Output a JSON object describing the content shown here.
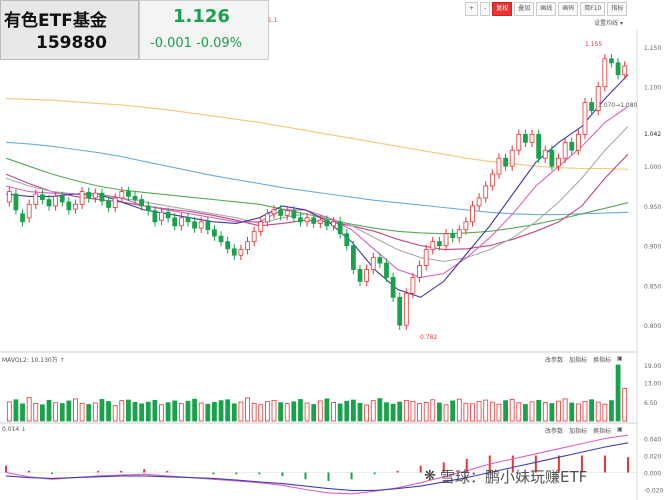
{
  "fund": {
    "name": "有色ETF基金",
    "code": "159880",
    "price": "1.126",
    "change": "-0.001",
    "change_pct": "-0.09%"
  },
  "toolbar": {
    "buttons": [
      "+",
      "-",
      "复权",
      "叠加",
      "画线",
      "画码",
      "简F10",
      "指标"
    ],
    "active_index": 2
  },
  "settings_label": "设置均线",
  "main_labels": {
    "high_label": "1.155",
    "ref_label": "1.070→1.080",
    "low_label": "0.782",
    "top_marker": "1.1"
  },
  "indicator_vol": {
    "label": "MAVOL2: 10.130万",
    "buttons": [
      "改参数",
      "加指标",
      "换指标"
    ]
  },
  "indicator_macd": {
    "label": "0.014",
    "buttons": [
      "改参数",
      "加指标",
      "换指标"
    ]
  },
  "watermark": "雪球：鹏小妹玩赚ETF",
  "watermark_logo": "❋",
  "colors": {
    "up": "#ee3333",
    "down": "#17a34a"
  },
  "chart_data": {
    "type": "candlestick",
    "y_ticks": [
      "1.150",
      "1.100",
      "1.042",
      "1.000",
      "0.950",
      "0.900",
      "0.850",
      "0.800"
    ],
    "y_ticks_vol": [
      "19.00",
      "13.00",
      "6.50"
    ],
    "y_ticks_macd": [
      "0.040",
      "0.020",
      "0.000",
      "-0.020"
    ],
    "ma_series": [
      {
        "color": "#f5c87a",
        "values": [
          1.085,
          1.084,
          1.083,
          1.081,
          1.079,
          1.077,
          1.074,
          1.071,
          1.067,
          1.063,
          1.059,
          1.055,
          1.05,
          1.045,
          1.04,
          1.035,
          1.03,
          1.025,
          1.02,
          1.015,
          1.01,
          1.006,
          1.003,
          1.0,
          0.998,
          0.997,
          0.997,
          0.996
        ]
      },
      {
        "color": "#6ab0d8",
        "values": [
          1.03,
          1.028,
          1.025,
          1.021,
          1.017,
          1.012,
          1.006,
          1.0,
          0.994,
          0.988,
          0.983,
          0.978,
          0.973,
          0.969,
          0.965,
          0.961,
          0.957,
          0.954,
          0.951,
          0.948,
          0.945,
          0.942,
          0.94,
          0.939,
          0.939,
          0.94,
          0.941,
          0.942
        ]
      },
      {
        "color": "#57a85a",
        "values": [
          1.01,
          1.0,
          0.99,
          0.982,
          0.975,
          0.97,
          0.967,
          0.964,
          0.961,
          0.958,
          0.955,
          0.952,
          0.946,
          0.94,
          0.933,
          0.927,
          0.922,
          0.918,
          0.916,
          0.915,
          0.916,
          0.918,
          0.922,
          0.927,
          0.933,
          0.94,
          0.947,
          0.954
        ]
      },
      {
        "color": "#c0468a",
        "values": [
          0.99,
          0.978,
          0.968,
          0.962,
          0.958,
          0.955,
          0.95,
          0.946,
          0.943,
          0.938,
          0.932,
          0.925,
          0.928,
          0.932,
          0.93,
          0.925,
          0.918,
          0.908,
          0.9,
          0.895,
          0.896,
          0.9,
          0.908,
          0.918,
          0.93,
          0.95,
          0.985,
          1.015
        ]
      },
      {
        "color": "#aaaaaa",
        "values": [
          0.985,
          0.975,
          0.968,
          0.965,
          0.962,
          0.96,
          0.955,
          0.95,
          0.945,
          0.94,
          0.935,
          0.928,
          0.935,
          0.94,
          0.935,
          0.925,
          0.91,
          0.895,
          0.885,
          0.88,
          0.885,
          0.895,
          0.91,
          0.93,
          0.955,
          0.985,
          1.02,
          1.05
        ]
      },
      {
        "color": "#e060c0",
        "values": [
          0.975,
          0.968,
          0.966,
          0.965,
          0.965,
          0.96,
          0.95,
          0.945,
          0.94,
          0.935,
          0.93,
          0.93,
          0.945,
          0.945,
          0.935,
          0.92,
          0.895,
          0.87,
          0.86,
          0.865,
          0.885,
          0.91,
          0.94,
          0.975,
          1.0,
          1.025,
          1.055,
          1.075
        ]
      },
      {
        "color": "#3a3aa0",
        "values": [
          0.965,
          0.962,
          0.962,
          0.965,
          0.965,
          0.955,
          0.945,
          0.94,
          0.935,
          0.93,
          0.928,
          0.935,
          0.95,
          0.945,
          0.93,
          0.905,
          0.87,
          0.845,
          0.835,
          0.855,
          0.89,
          0.925,
          0.965,
          1.005,
          1.03,
          1.05,
          1.085,
          1.115
        ]
      }
    ],
    "candles": [
      [
        0.955,
        0.968
      ],
      [
        0.965,
        0.945
      ],
      [
        0.94,
        0.93
      ],
      [
        0.935,
        0.952
      ],
      [
        0.952,
        0.965
      ],
      [
        0.964,
        0.958
      ],
      [
        0.958,
        0.95
      ],
      [
        0.95,
        0.962
      ],
      [
        0.962,
        0.955
      ],
      [
        0.955,
        0.945
      ],
      [
        0.946,
        0.952
      ],
      [
        0.952,
        0.968
      ],
      [
        0.967,
        0.96
      ],
      [
        0.96,
        0.966
      ],
      [
        0.966,
        0.956
      ],
      [
        0.956,
        0.948
      ],
      [
        0.948,
        0.96
      ],
      [
        0.96,
        0.968
      ],
      [
        0.968,
        0.962
      ],
      [
        0.962,
        0.958
      ],
      [
        0.958,
        0.95
      ],
      [
        0.95,
        0.944
      ],
      [
        0.944,
        0.93
      ],
      [
        0.932,
        0.942
      ],
      [
        0.942,
        0.935
      ],
      [
        0.935,
        0.925
      ],
      [
        0.925,
        0.935
      ],
      [
        0.935,
        0.93
      ],
      [
        0.93,
        0.922
      ],
      [
        0.922,
        0.93
      ],
      [
        0.93,
        0.92
      ],
      [
        0.92,
        0.912
      ],
      [
        0.912,
        0.905
      ],
      [
        0.905,
        0.896
      ],
      [
        0.896,
        0.888
      ],
      [
        0.888,
        0.895
      ],
      [
        0.895,
        0.905
      ],
      [
        0.905,
        0.918
      ],
      [
        0.918,
        0.93
      ],
      [
        0.93,
        0.94
      ],
      [
        0.94,
        0.945
      ],
      [
        0.945,
        0.938
      ],
      [
        0.938,
        0.944
      ],
      [
        0.944,
        0.935
      ],
      [
        0.935,
        0.93
      ],
      [
        0.93,
        0.935
      ],
      [
        0.935,
        0.928
      ],
      [
        0.928,
        0.932
      ],
      [
        0.932,
        0.925
      ],
      [
        0.925,
        0.93
      ],
      [
        0.93,
        0.915
      ],
      [
        0.915,
        0.9
      ],
      [
        0.9,
        0.87
      ],
      [
        0.87,
        0.855
      ],
      [
        0.855,
        0.87
      ],
      [
        0.87,
        0.885
      ],
      [
        0.885,
        0.878
      ],
      [
        0.878,
        0.86
      ],
      [
        0.86,
        0.835
      ],
      [
        0.835,
        0.8
      ],
      [
        0.8,
        0.84
      ],
      [
        0.84,
        0.86
      ],
      [
        0.86,
        0.875
      ],
      [
        0.875,
        0.895
      ],
      [
        0.895,
        0.905
      ],
      [
        0.905,
        0.9
      ],
      [
        0.9,
        0.915
      ],
      [
        0.915,
        0.91
      ],
      [
        0.91,
        0.92
      ],
      [
        0.92,
        0.93
      ],
      [
        0.93,
        0.95
      ],
      [
        0.95,
        0.96
      ],
      [
        0.96,
        0.975
      ],
      [
        0.975,
        0.99
      ],
      [
        0.99,
        1.01
      ],
      [
        1.01,
        1.0
      ],
      [
        1.0,
        1.02
      ],
      [
        1.02,
        1.04
      ],
      [
        1.04,
        1.03
      ],
      [
        1.03,
        1.04
      ],
      [
        1.04,
        1.01
      ],
      [
        1.01,
        1.02
      ],
      [
        1.02,
        1.0
      ],
      [
        1.0,
        1.01
      ],
      [
        1.01,
        1.03
      ],
      [
        1.03,
        1.02
      ],
      [
        1.02,
        1.04
      ],
      [
        1.04,
        1.08
      ],
      [
        1.08,
        1.07
      ],
      [
        1.07,
        1.1
      ],
      [
        1.1,
        1.135
      ],
      [
        1.135,
        1.13
      ],
      [
        1.13,
        1.115
      ],
      [
        1.115,
        1.126
      ]
    ],
    "volumes": [
      6.5,
      7.2,
      5.8,
      8.0,
      6.0,
      5.5,
      7.0,
      6.2,
      5.9,
      6.8,
      7.5,
      6.0,
      5.6,
      6.1,
      7.3,
      6.6,
      5.2,
      6.9,
      7.1,
      6.3,
      5.8,
      6.4,
      7.0,
      5.5,
      6.2,
      6.8,
      5.9,
      6.7,
      7.4,
      6.1,
      5.7,
      6.3,
      6.9,
      7.2,
      5.8,
      6.4,
      7.8,
      6.0,
      5.5,
      6.6,
      7.0,
      6.2,
      5.9,
      6.5,
      7.3,
      6.1,
      5.6,
      6.8,
      7.5,
      6.3,
      5.8,
      6.7,
      7.1,
      6.0,
      5.4,
      6.9,
      7.6,
      6.2,
      5.7,
      6.4,
      7.0,
      6.6,
      5.9,
      6.3,
      7.2,
      6.1,
      5.5,
      6.8,
      7.4,
      6.0,
      5.8,
      6.6,
      7.1,
      6.4,
      5.7,
      6.9,
      7.3,
      6.2,
      5.6,
      6.5,
      7.0,
      6.3,
      5.9,
      6.7,
      7.5,
      6.1,
      5.8,
      6.6,
      7.2,
      6.4,
      5.7,
      6.9,
      19.0,
      11.0
    ],
    "macd_lines": [
      {
        "color": "#e060c0",
        "values": [
          0.0,
          -0.005,
          -0.008,
          -0.006,
          -0.004,
          -0.003,
          -0.002,
          -0.004,
          -0.006,
          -0.008,
          -0.01,
          -0.012,
          -0.015,
          -0.02,
          -0.024,
          -0.025,
          -0.022,
          -0.018,
          -0.012,
          -0.005,
          0.002,
          0.01,
          0.016,
          0.022,
          0.028,
          0.034,
          0.04,
          0.044
        ]
      },
      {
        "color": "#4040b0",
        "values": [
          -0.004,
          -0.006,
          -0.007,
          -0.006,
          -0.005,
          -0.004,
          -0.004,
          -0.005,
          -0.006,
          -0.007,
          -0.009,
          -0.011,
          -0.013,
          -0.016,
          -0.019,
          -0.021,
          -0.021,
          -0.019,
          -0.016,
          -0.011,
          -0.006,
          0.0,
          0.006,
          0.012,
          0.018,
          0.024,
          0.03,
          0.035
        ]
      }
    ]
  }
}
